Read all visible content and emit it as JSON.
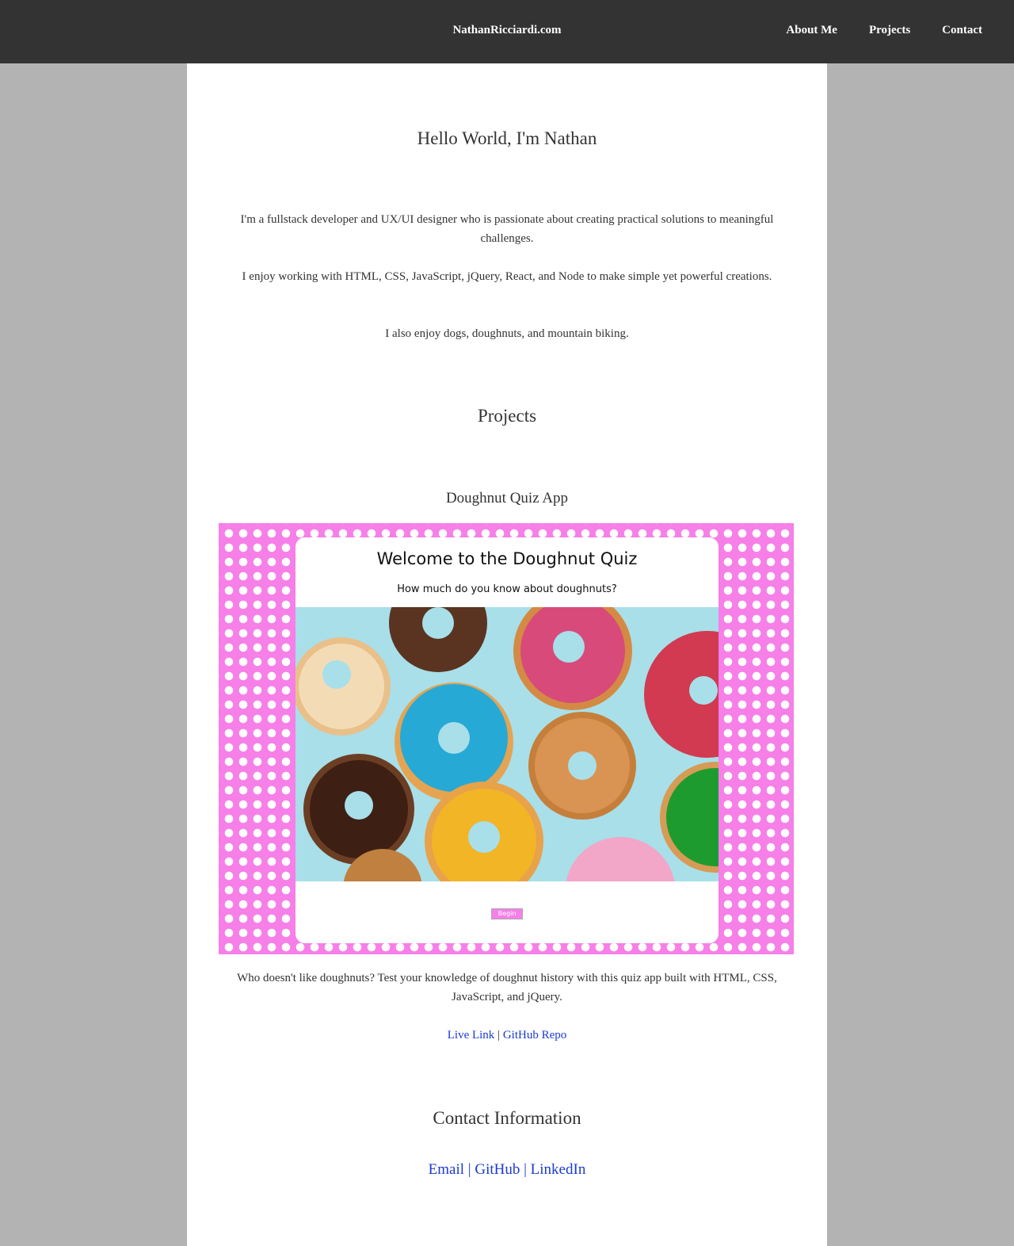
{
  "nav": {
    "brand": "NathanRicciardi.com",
    "links": [
      "About Me",
      "Projects",
      "Contact"
    ]
  },
  "about": {
    "heading": "Hello World, I'm Nathan",
    "p1": "I'm a fullstack developer and UX/UI designer who is passionate about creating practical solutions to meaningful challenges.",
    "p2": "I enjoy working with HTML, CSS, JavaScript, jQuery, React, and Node to make simple yet powerful creations.",
    "p3": "I also enjoy dogs, doughnuts, and mountain biking."
  },
  "projects": {
    "heading": "Projects",
    "items": [
      {
        "title": "Doughnut Quiz App",
        "screenshot": {
          "title": "Welcome to the Doughnut Quiz",
          "subtitle": "How much do you know about doughnuts?",
          "button": "Begin"
        },
        "description": "Who doesn't like doughnuts? Test your knowledge of doughnut history with this quiz app built with HTML, CSS, JavaScript, and jQuery.",
        "live_link": "Live Link",
        "separator": "|",
        "repo_link": "GitHub Repo"
      }
    ]
  },
  "contact": {
    "heading": "Contact Information",
    "email": "Email",
    "github": "GitHub",
    "linkedin": "LinkedIn",
    "separator": "|"
  },
  "colors": {
    "navbar": "#333333",
    "page_bg": "#b3b3b3",
    "content_bg": "#ffffff",
    "link": "#1a3acf",
    "polka_pink": "#f67fe8"
  }
}
